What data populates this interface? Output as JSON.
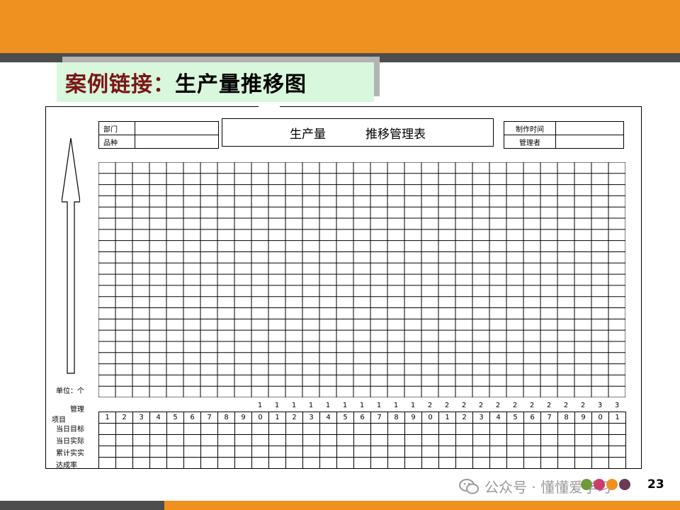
{
  "slide": {
    "title_red": "案例链接：",
    "title_black": "生产量推移图",
    "page_number": "23"
  },
  "form": {
    "dept_label": "部门",
    "variety_label": "品种",
    "heading_left": "生产量",
    "heading_right": "推移管理表",
    "made_time_label": "制作时间",
    "manager_label": "管理者",
    "unit_label": "单位：个",
    "manage_label": "管理",
    "item_label": "项目",
    "rows": [
      "当日目标",
      "当日实际",
      "累计实实",
      "达成率"
    ],
    "day_tens": [
      "",
      "",
      "",
      "",
      "",
      "",
      "",
      "",
      "",
      "1",
      "1",
      "1",
      "1",
      "1",
      "1",
      "1",
      "1",
      "1",
      "1",
      "2",
      "2",
      "2",
      "2",
      "2",
      "2",
      "2",
      "2",
      "2",
      "2",
      "3",
      "3"
    ],
    "day_units": [
      "1",
      "2",
      "3",
      "4",
      "5",
      "6",
      "7",
      "8",
      "9",
      "0",
      "1",
      "2",
      "3",
      "4",
      "5",
      "6",
      "7",
      "8",
      "9",
      "0",
      "1",
      "2",
      "3",
      "4",
      "5",
      "6",
      "7",
      "8",
      "9",
      "0",
      "1"
    ]
  },
  "watermark": {
    "text": "公众号 · 懂懂爱学习",
    "icon": "wechat-icon"
  },
  "colors": {
    "orange": "#EE9121",
    "dark_gray": "#4D4D4D",
    "title_bg": "#D9F7DC",
    "title_red": "#7A1515",
    "dots": [
      "#6E9A3B",
      "#C83C6E",
      "#EE9121",
      "#6B3A55"
    ]
  }
}
